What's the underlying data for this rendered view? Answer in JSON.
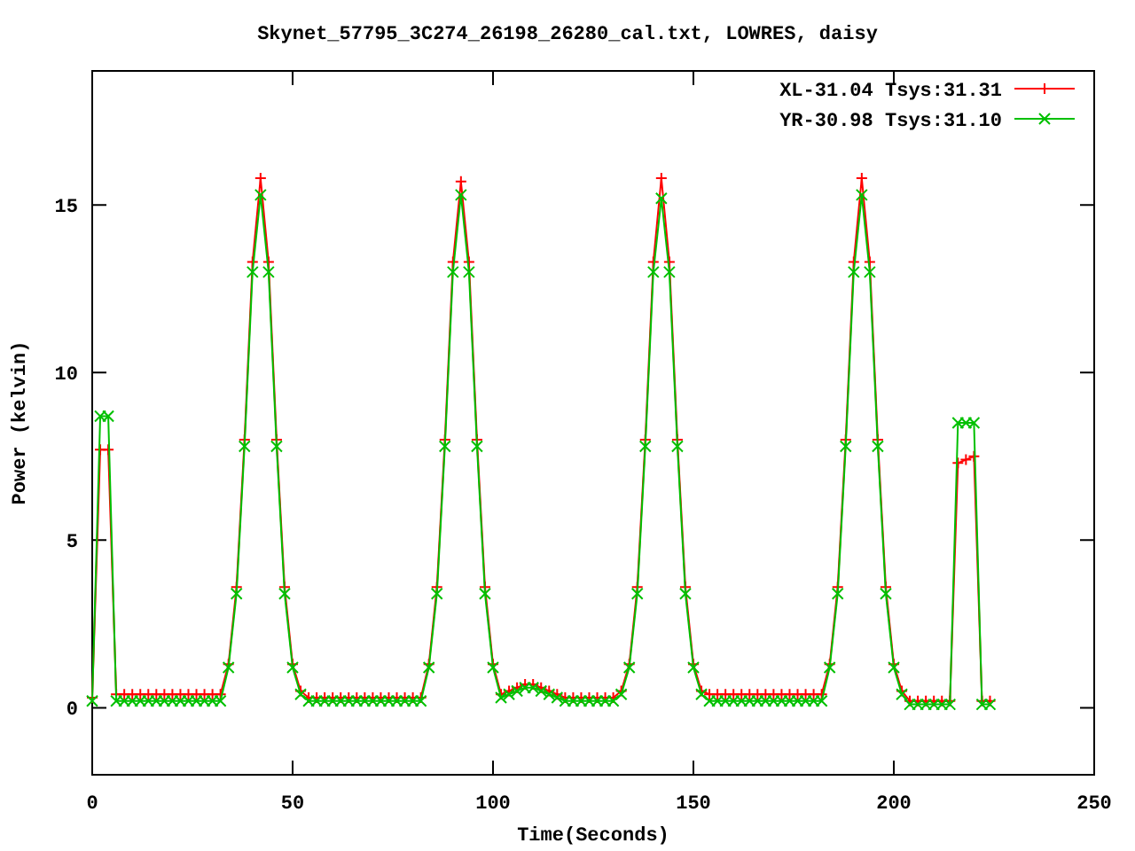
{
  "plot": {
    "chart_data": {
      "type": "line",
      "title": "Skynet_57795_3C274_26198_26280_cal.txt, LOWRES, daisy",
      "xlabel": "Time(Seconds)",
      "ylabel": "Power (kelvin)",
      "xlim": [
        0,
        250
      ],
      "ylim": [
        -2,
        19
      ],
      "xticks": [
        0,
        50,
        100,
        150,
        200,
        250
      ],
      "yticks": [
        0,
        5,
        10,
        15
      ],
      "legend": true,
      "x": [
        0,
        2,
        4,
        6,
        8,
        10,
        12,
        14,
        16,
        18,
        20,
        22,
        24,
        26,
        28,
        30,
        32,
        34,
        36,
        38,
        40,
        42,
        44,
        46,
        48,
        50,
        52,
        54,
        56,
        58,
        60,
        62,
        64,
        66,
        68,
        70,
        72,
        74,
        76,
        78,
        80,
        82,
        84,
        86,
        88,
        90,
        92,
        94,
        96,
        98,
        100,
        102,
        104,
        106,
        108,
        110,
        112,
        114,
        116,
        118,
        120,
        122,
        124,
        126,
        128,
        130,
        132,
        134,
        136,
        138,
        140,
        142,
        144,
        146,
        148,
        150,
        152,
        154,
        156,
        158,
        160,
        162,
        164,
        166,
        168,
        170,
        172,
        174,
        176,
        178,
        180,
        182,
        184,
        186,
        188,
        190,
        192,
        194,
        196,
        198,
        200,
        202,
        204,
        206,
        208,
        210,
        212,
        214,
        216,
        218,
        220,
        222,
        224
      ],
      "series": [
        {
          "name": "XL-31.04 Tsys:31.31",
          "color": "#ff0000",
          "marker": "plus",
          "values": [
            0.3,
            7.7,
            7.7,
            0.4,
            0.4,
            0.4,
            0.4,
            0.4,
            0.4,
            0.4,
            0.4,
            0.4,
            0.4,
            0.4,
            0.4,
            0.4,
            0.4,
            1.3,
            3.6,
            8.0,
            13.3,
            15.8,
            13.3,
            8.0,
            3.6,
            1.3,
            0.5,
            0.3,
            0.3,
            0.3,
            0.3,
            0.3,
            0.3,
            0.3,
            0.3,
            0.3,
            0.3,
            0.3,
            0.3,
            0.3,
            0.3,
            0.3,
            1.3,
            3.6,
            8.0,
            13.3,
            15.7,
            13.3,
            8.0,
            3.6,
            1.3,
            0.4,
            0.5,
            0.6,
            0.7,
            0.7,
            0.6,
            0.5,
            0.4,
            0.3,
            0.3,
            0.3,
            0.3,
            0.3,
            0.3,
            0.3,
            0.5,
            1.3,
            3.6,
            8.0,
            13.3,
            15.8,
            13.3,
            8.0,
            3.6,
            1.3,
            0.5,
            0.4,
            0.4,
            0.4,
            0.4,
            0.4,
            0.4,
            0.4,
            0.4,
            0.4,
            0.4,
            0.4,
            0.4,
            0.4,
            0.4,
            0.4,
            1.3,
            3.6,
            8.0,
            13.3,
            15.8,
            13.3,
            8.0,
            3.6,
            1.3,
            0.5,
            0.2,
            0.2,
            0.2,
            0.2,
            0.2,
            0.2,
            7.3,
            7.4,
            7.5,
            0.2,
            0.2
          ]
        },
        {
          "name": "YR-30.98 Tsys:31.10",
          "color": "#00c000",
          "marker": "cross",
          "values": [
            0.2,
            8.7,
            8.7,
            0.2,
            0.2,
            0.2,
            0.2,
            0.2,
            0.2,
            0.2,
            0.2,
            0.2,
            0.2,
            0.2,
            0.2,
            0.2,
            0.2,
            1.2,
            3.4,
            7.8,
            13.0,
            15.3,
            13.0,
            7.8,
            3.4,
            1.2,
            0.4,
            0.2,
            0.2,
            0.2,
            0.2,
            0.2,
            0.2,
            0.2,
            0.2,
            0.2,
            0.2,
            0.2,
            0.2,
            0.2,
            0.2,
            0.2,
            1.2,
            3.4,
            7.8,
            13.0,
            15.3,
            13.0,
            7.8,
            3.4,
            1.2,
            0.3,
            0.4,
            0.5,
            0.6,
            0.6,
            0.5,
            0.4,
            0.3,
            0.2,
            0.2,
            0.2,
            0.2,
            0.2,
            0.2,
            0.2,
            0.4,
            1.2,
            3.4,
            7.8,
            13.0,
            15.2,
            13.0,
            7.8,
            3.4,
            1.2,
            0.4,
            0.2,
            0.2,
            0.2,
            0.2,
            0.2,
            0.2,
            0.2,
            0.2,
            0.2,
            0.2,
            0.2,
            0.2,
            0.2,
            0.2,
            0.2,
            1.2,
            3.4,
            7.8,
            13.0,
            15.3,
            13.0,
            7.8,
            3.4,
            1.2,
            0.4,
            0.1,
            0.1,
            0.1,
            0.1,
            0.1,
            0.1,
            8.5,
            8.5,
            8.5,
            0.1,
            0.1
          ]
        }
      ]
    }
  }
}
